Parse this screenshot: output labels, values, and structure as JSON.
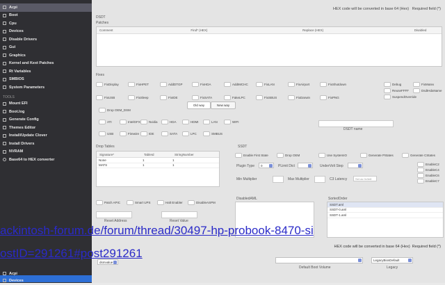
{
  "sidebar": {
    "items": [
      {
        "label": "Acpi",
        "active": true
      },
      {
        "label": "Boot"
      },
      {
        "label": "Cpu"
      },
      {
        "label": "Devices"
      },
      {
        "label": "Disable Drivers"
      },
      {
        "label": "Gui"
      },
      {
        "label": "Graphics"
      },
      {
        "label": "Kernel and Kext Patches"
      },
      {
        "label": "Rt Variables"
      },
      {
        "label": "SMBIOS"
      },
      {
        "label": "System Parameters"
      }
    ],
    "tools_header": "TOOLS",
    "tools": [
      {
        "label": "Mount EFI"
      },
      {
        "label": "Boot.log"
      },
      {
        "label": "Generate Config"
      },
      {
        "label": "Themes Editor"
      },
      {
        "label": "Install/Update Clover"
      },
      {
        "label": "Install Drivers"
      },
      {
        "label": "NVRAM"
      },
      {
        "label": "Base64 to HEX converter"
      }
    ]
  },
  "main": {
    "hex_note": "HEX code will be converted in base 64 (Hex)",
    "required_note": "Required field (*)",
    "dsdt_label": "DSDT",
    "patches_label": "Patches",
    "patches_columns": [
      "Comment",
      "Find* (HEX)",
      "Replace (HEX)",
      "Disabled"
    ],
    "fixes_label": "Fixes",
    "fixes_row1": [
      "FixDisplay",
      "FixHPET",
      "AddDTGP",
      "FixHDA",
      "AddIMCHC",
      "FixLAN",
      "FixAirport",
      "FixShutdown"
    ],
    "fixes_row2": [
      "FixUSB",
      "FixSleep",
      "FixIDE",
      "FixSATA",
      "FakeLPC",
      "FixSBUS",
      "FixDarwin",
      "FixPNG"
    ],
    "fixes_right": [
      "Debug",
      "ReuseFFFF",
      "SuspendOverride"
    ],
    "fixes_right2": [
      "FixMutex",
      "DsdtHdaName"
    ],
    "drop_ssdt": "Drop OEM_DSM",
    "old_way": "Old way",
    "new_way": "New way",
    "dsm_row1": [
      "ATI",
      "IntelGFX",
      "Nvidia",
      "HDA",
      "HDMI",
      "LAN",
      "WIFI"
    ],
    "dsm_row2": [
      "USB",
      "Firewire",
      "IDE",
      "SATA",
      "LPC",
      "SMBUS"
    ],
    "dsdt_name_label": "DSDT name",
    "drop_tables_label": "Drop Tables",
    "drop_tables_columns": [
      "Signature*",
      "TableId",
      "StringNumber"
    ],
    "drop_tables_rows": [
      {
        "sig": "None",
        "id": "1",
        "num": "1"
      },
      {
        "sig": "MATS",
        "id": "1",
        "num": "1"
      }
    ],
    "ssdt_label": "SSDT",
    "ssdt_checks": [
      "Enable First State",
      "Drop OEM",
      "Use SystemIO",
      "Generate PStates",
      "Generate CStates"
    ],
    "plugin_type_label": "Plugin Type",
    "plugin_type_value": "0",
    "pluse_ocx_label": "PLimit Dict",
    "undervolt_label": "UnderVolt Step",
    "min_mult_label": "Min Multiplier",
    "max_mult_label": "Max Multiplier",
    "c3_label": "C3 Latency",
    "c3_value": "Set as 0x3e8",
    "enable_c": [
      "EnableC2",
      "EnableC4",
      "EnableC6",
      "EnableC7"
    ],
    "bottom_checks": [
      "Patch APIC",
      "Smart UPS",
      "Halt Enabler",
      "DisableASPM"
    ],
    "reset_address": "Reset Address",
    "reset_value": "Reset Value",
    "disabled_aml": "DisabledAML",
    "sorted_order": "SortedOrder",
    "sorted_items": [
      "SSDT.aml",
      "SSDT-0.aml",
      "SSDT-1.aml"
    ]
  },
  "link": {
    "line1": "ackintosh-forum.de/forum/thread/30497-hp-probook-8470-si",
    "line2": "ostID=291261#post291261"
  },
  "second_window": {
    "hex_note": "HEX code will be converted in base 64 (Hex)",
    "required_note": "Required field (*)",
    "sidebar_items": [
      "Acpi",
      "Cpu",
      "Devices"
    ],
    "field_row": [
      "dsmvalue",
      "AddEE",
      "AddGTI",
      "Apwi",
      "AddHDMI",
      "debug GUTB"
    ],
    "default_boot_volume": "Default Boot Volume",
    "legacy_value": "LegacyBiosDefault",
    "legacy_label": "Legacy"
  },
  "colors": {
    "sidebar_bg": "#2f2f33",
    "accent": "#2d6fd6",
    "link": "#2a2ac8"
  }
}
